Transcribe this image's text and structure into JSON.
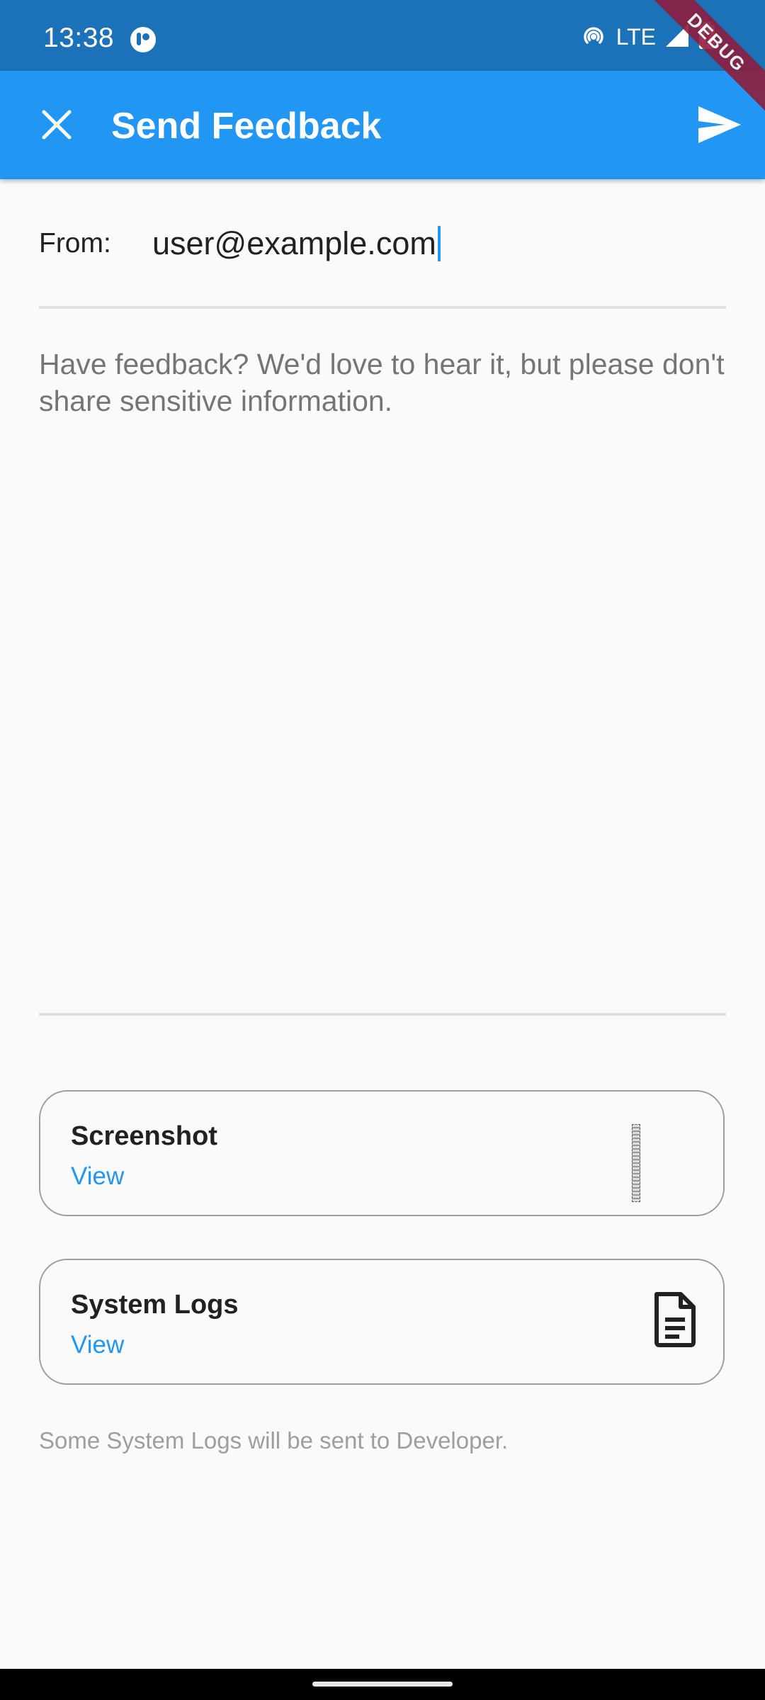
{
  "status_bar": {
    "time": "13:38",
    "network": "LTE",
    "icons": [
      "app-icon",
      "hotspot-icon",
      "signal-icon",
      "battery-icon"
    ]
  },
  "debug_banner": "DEBUG",
  "app_bar": {
    "title": "Send Feedback",
    "close_icon": "close-icon",
    "send_icon": "send-icon",
    "color": "#2196f3"
  },
  "form": {
    "from_label": "From:",
    "from_value": "user@example.com",
    "feedback_placeholder": "Have feedback? We'd love to hear it, but please don't share sensitive information.",
    "feedback_value": ""
  },
  "attachments": [
    {
      "title": "Screenshot",
      "link": "View",
      "icon": "screenshot-thumbnail"
    },
    {
      "title": "System Logs",
      "link": "View",
      "icon": "document-icon"
    }
  ],
  "footer_note": "Some System Logs will be sent to Developer.",
  "colors": {
    "status_bar": "#1c72b8",
    "accent": "#2196f3",
    "debug_banner": "#8e1e3d"
  }
}
